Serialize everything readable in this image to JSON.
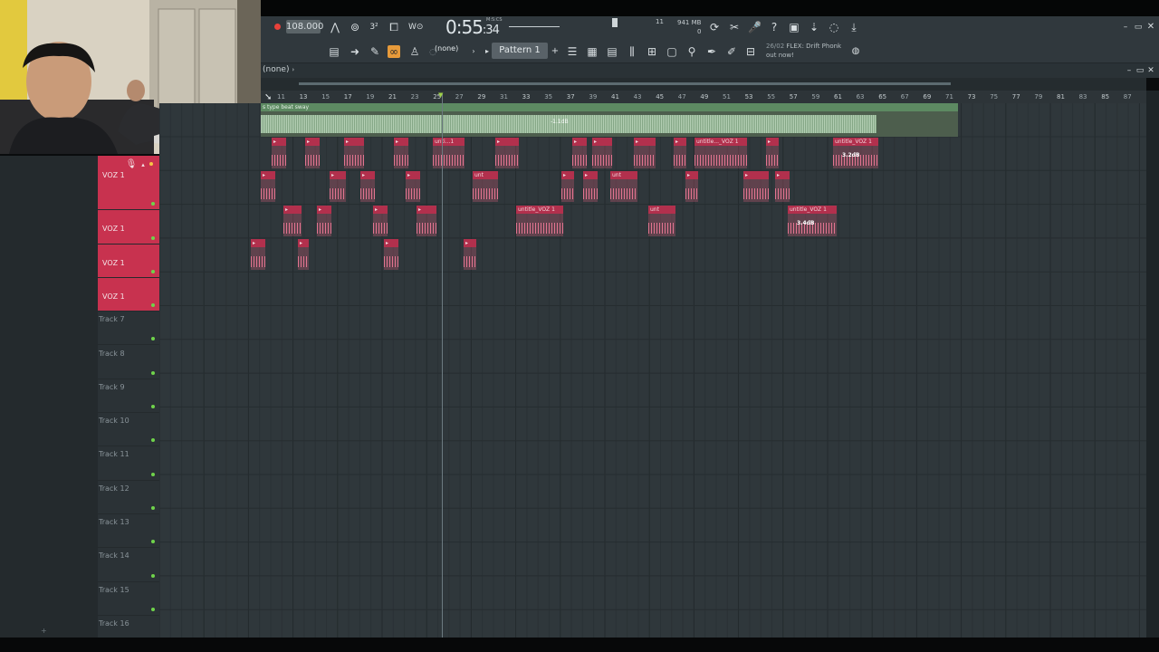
{
  "toolbar": {
    "tempo": "108.000",
    "time": "0:55",
    "time_frac": ":34",
    "time_unit": "M:S:CS",
    "cpu": "11",
    "memory": "941 MB",
    "memory2": "0",
    "pattern": "Pattern 1",
    "channel_select": "(none)",
    "hint_date": "26/02",
    "hint_line1": "FLEX: Drift Phonk",
    "hint_line2": "out now!"
  },
  "playlist": {
    "breadcrumb": "(none)",
    "ruler": [
      "11",
      "13",
      "15",
      "17",
      "19",
      "21",
      "23",
      "25",
      "27",
      "29",
      "31",
      "33",
      "35",
      "37",
      "39",
      "41",
      "43",
      "45",
      "47",
      "49",
      "51",
      "53",
      "55",
      "57",
      "59",
      "61",
      "63",
      "65",
      "67",
      "69",
      "71",
      "73",
      "75",
      "77",
      "79",
      "81",
      "83",
      "85",
      "87"
    ],
    "audio_clip": {
      "name": "s type beat sway",
      "gain": "-1.1dB"
    },
    "tracks": [
      {
        "label": "VOZ 1",
        "voz": true
      },
      {
        "label": "VOZ 1",
        "voz": true
      },
      {
        "label": "VOZ 1",
        "voz": true
      },
      {
        "label": "VOZ 1",
        "voz": true
      },
      {
        "label": "Track 7",
        "voz": false
      },
      {
        "label": "Track 8",
        "voz": false
      },
      {
        "label": "Track 9",
        "voz": false
      },
      {
        "label": "Track 10",
        "voz": false
      },
      {
        "label": "Track 11",
        "voz": false
      },
      {
        "label": "Track 12",
        "voz": false
      },
      {
        "label": "Track 13",
        "voz": false
      },
      {
        "label": "Track 14",
        "voz": false
      },
      {
        "label": "Track 15",
        "voz": false
      },
      {
        "label": "Track 16",
        "voz": false
      }
    ],
    "clip_labels": {
      "c1": "unti...1",
      "c2": "unt",
      "c3": "untitle..._VOZ 1",
      "c4": "untitle_VOZ 1",
      "c5": "unt",
      "c6": "untitle_VOZ 1",
      "c7": "unt",
      "c8": "untitle_VOZ 1",
      "c9": "unt",
      "g1": "3.2dB",
      "g2": "3.4dB"
    }
  }
}
